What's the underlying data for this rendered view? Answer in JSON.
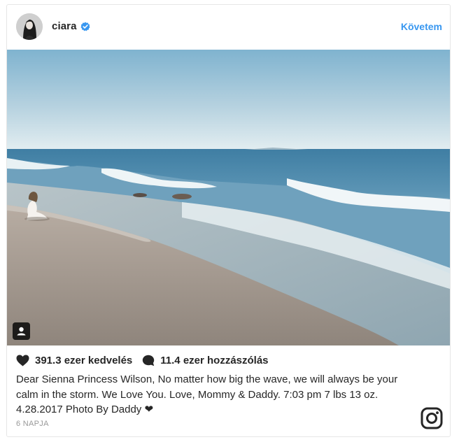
{
  "header": {
    "username": "ciara",
    "follow_label": "Követem"
  },
  "photo": {
    "description_icon": "tagged-people-icon"
  },
  "stats": {
    "likes": "391.3 ezer kedvelés",
    "comments": "11.4 ezer hozzászólás"
  },
  "caption": "Dear Sienna Princess Wilson, No matter how big the wave, we will always be your calm in the storm. We Love You. Love, Mommy & Daddy. 7:03 pm 7 lbs 13 oz. 4.28.2017 Photo By Daddy ❤",
  "time_ago": "6 NAPJA",
  "colors": {
    "accent": "#3897f0",
    "text": "#262626",
    "muted": "#999999",
    "verified": "#3897f0"
  },
  "icons": [
    "heart-icon",
    "comment-icon",
    "verified-badge-icon",
    "instagram-logo-icon",
    "tagged-people-icon"
  ]
}
